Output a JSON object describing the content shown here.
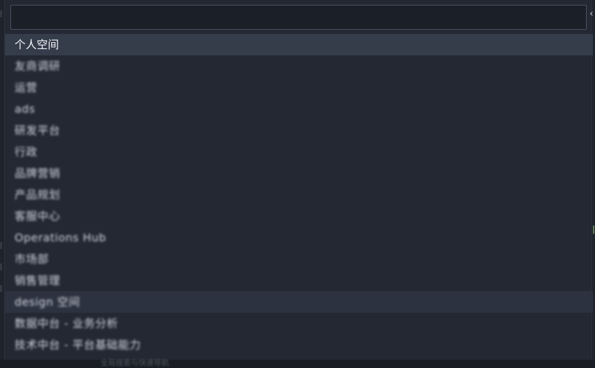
{
  "search": {
    "value": "",
    "placeholder": ""
  },
  "items": [
    {
      "label": "个人空间",
      "state": "active",
      "blurred": false
    },
    {
      "label": "友商调研",
      "state": "",
      "blurred": true
    },
    {
      "label": "运营",
      "state": "",
      "blurred": true
    },
    {
      "label": "ads",
      "state": "",
      "blurred": true
    },
    {
      "label": "研发平台",
      "state": "",
      "blurred": true
    },
    {
      "label": "行政",
      "state": "",
      "blurred": true
    },
    {
      "label": "品牌营销",
      "state": "",
      "blurred": true
    },
    {
      "label": "产品规划",
      "state": "",
      "blurred": true
    },
    {
      "label": "客服中心",
      "state": "",
      "blurred": true
    },
    {
      "label": "Operations Hub",
      "state": "",
      "blurred": true
    },
    {
      "label": "市场部",
      "state": "",
      "blurred": true
    },
    {
      "label": "销售管理",
      "state": "",
      "blurred": true
    },
    {
      "label": "design 空间",
      "state": "hover",
      "blurred": true
    },
    {
      "label": "数据中台 - 业务分析",
      "state": "",
      "blurred": true
    },
    {
      "label": "技术中台 - 平台基础能力",
      "state": "",
      "blurred": true
    }
  ],
  "bottom_hint": "全局搜索与快速导航"
}
